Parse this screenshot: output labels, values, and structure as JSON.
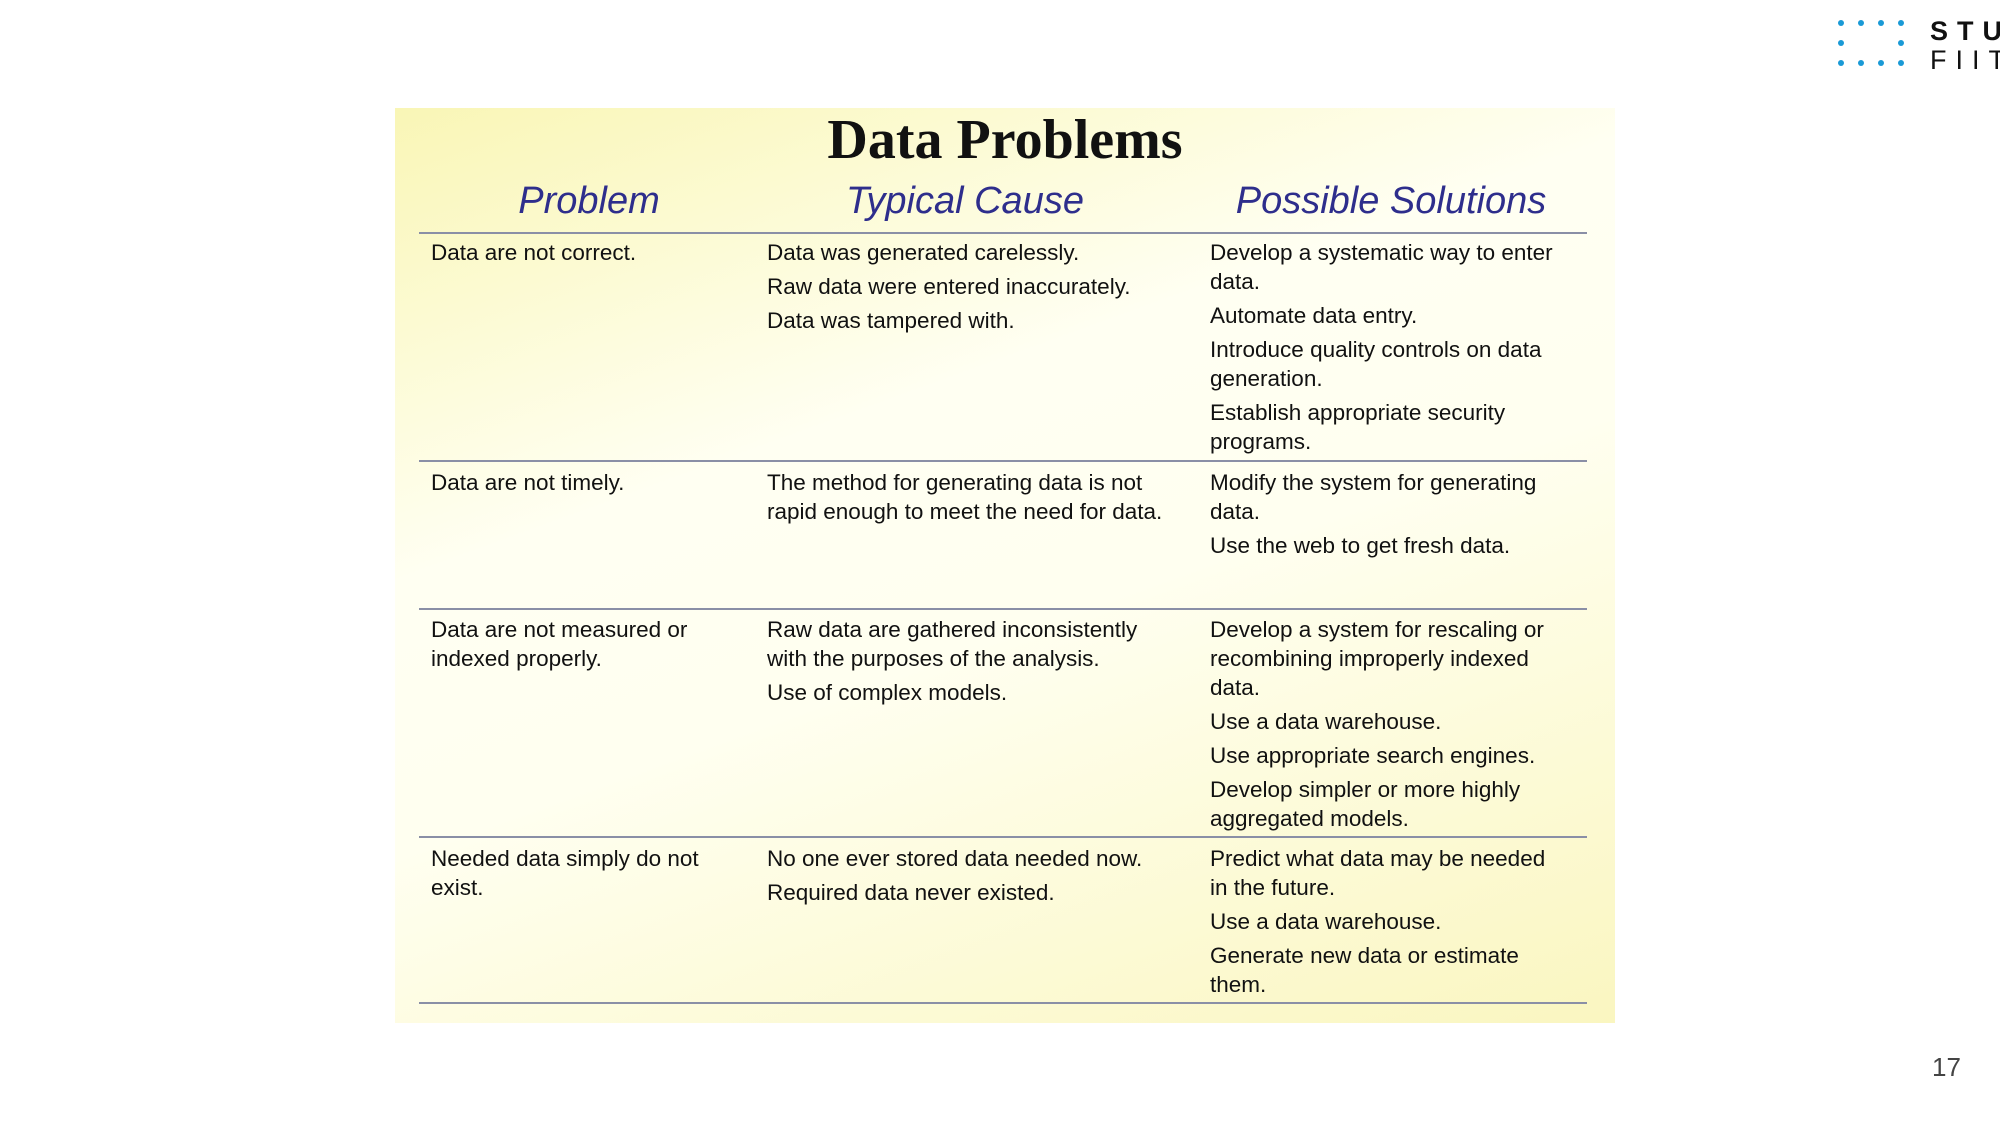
{
  "logo": {
    "line1": "STU",
    "line2": "FIIT",
    "color": "#1a9ad6"
  },
  "page_number": "17",
  "slide_image": {
    "title": "Data Problems",
    "headers": [
      "Problem",
      "Typical Cause",
      "Possible Solutions"
    ],
    "rows": [
      {
        "problem": [
          "Data are not correct."
        ],
        "causes": [
          "Data was generated carelessly.",
          "Raw data were entered inaccurately.",
          "Data was tampered with."
        ],
        "solutions": [
          [
            "Develop a systematic way to enter",
            "data."
          ],
          [
            "Automate data entry."
          ],
          [
            "Introduce quality controls on data",
            "generation."
          ],
          [
            "Establish appropriate security",
            "programs."
          ]
        ]
      },
      {
        "problem": [
          "Data are not timely."
        ],
        "causes": [
          "The method for generating data is not",
          "rapid enough to meet the need for data."
        ],
        "solutions": [
          [
            "Modify the system for generating",
            "data."
          ],
          [
            "Use the web to get fresh data."
          ]
        ]
      },
      {
        "problem": [
          "Data are not measured or",
          "indexed properly."
        ],
        "causes": [
          "Raw data are gathered inconsistently",
          "with the purposes of the analysis.",
          "Use of complex models."
        ],
        "solutions": [
          [
            "Develop a system for rescaling or",
            "recombining improperly indexed",
            "data."
          ],
          [
            "Use a data warehouse."
          ],
          [
            "Use appropriate search engines."
          ],
          [
            "Develop simpler or more highly",
            "aggregated models."
          ]
        ]
      },
      {
        "problem": [
          "Needed data simply do not",
          "exist."
        ],
        "causes": [
          "No one ever stored data needed now.",
          "Required data never existed."
        ],
        "solutions": [
          [
            "Predict what data may be needed",
            "in the future."
          ],
          [
            "Use a data warehouse."
          ],
          [
            "Generate new data or estimate",
            "them."
          ]
        ]
      }
    ]
  }
}
